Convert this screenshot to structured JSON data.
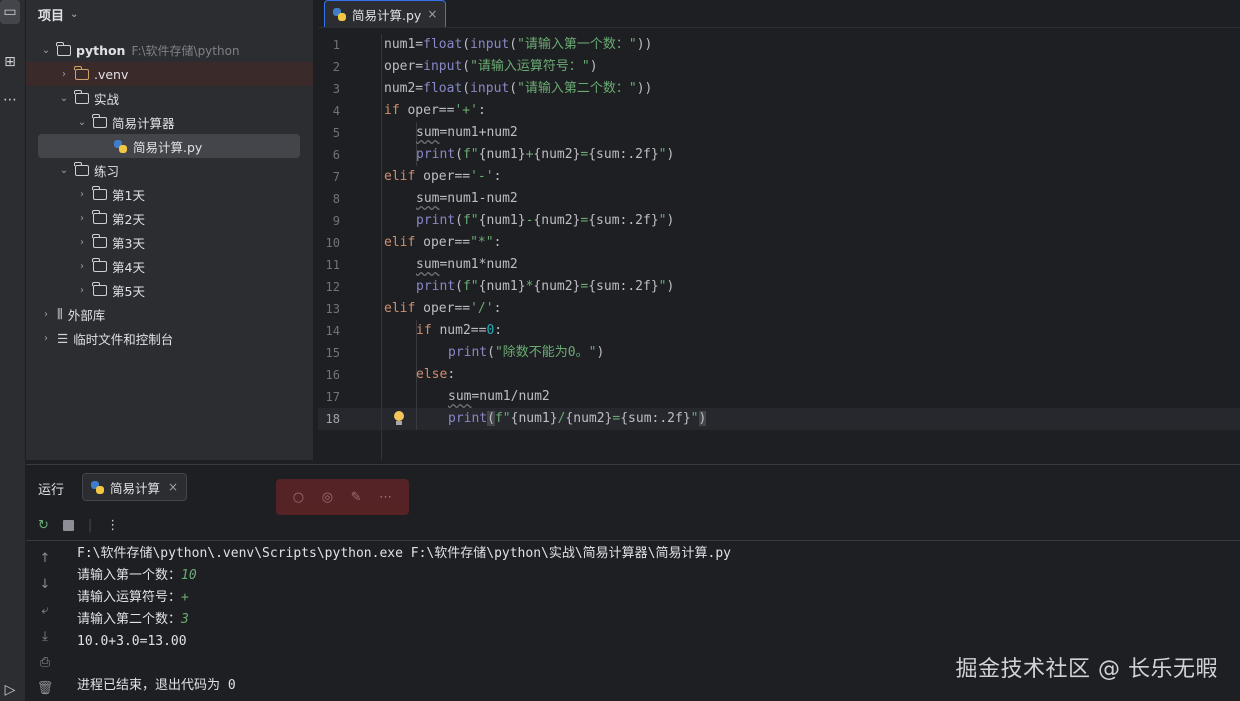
{
  "project_panel": {
    "title": "项目",
    "tree": [
      {
        "label": "python",
        "path": "F:\\软件存储\\python",
        "type": "folder",
        "expanded": true
      },
      {
        "label": ".venv",
        "type": "venv-folder",
        "expanded": false
      },
      {
        "label": "实战",
        "type": "folder",
        "expanded": true
      },
      {
        "label": "简易计算器",
        "type": "folder",
        "expanded": true
      },
      {
        "label": "简易计算.py",
        "type": "python-file"
      },
      {
        "label": "练习",
        "type": "folder",
        "expanded": true
      },
      {
        "label": "第1天",
        "type": "folder"
      },
      {
        "label": "第2天",
        "type": "folder"
      },
      {
        "label": "第3天",
        "type": "folder"
      },
      {
        "label": "第4天",
        "type": "folder"
      },
      {
        "label": "第5天",
        "type": "folder"
      },
      {
        "label": "外部库",
        "type": "library"
      },
      {
        "label": "临时文件和控制台",
        "type": "scratches"
      }
    ]
  },
  "editor": {
    "tab": "简易计算.py",
    "current_line": 18,
    "lines": [
      "1",
      "2",
      "3",
      "4",
      "5",
      "6",
      "7",
      "8",
      "9",
      "10",
      "11",
      "12",
      "13",
      "14",
      "15",
      "16",
      "17",
      "18"
    ],
    "code": {
      "l1": {
        "a": "num1=",
        "b": "float",
        "c": "(",
        "d": "input",
        "e": "(",
        "f": "\"请输入第一个数：\"",
        "g": "))"
      },
      "l2": {
        "a": "oper=",
        "b": "input",
        "c": "(",
        "d": "\"请输入运算符号：\"",
        "e": ")"
      },
      "l3": {
        "a": "num2=",
        "b": "float",
        "c": "(",
        "d": "input",
        "e": "(",
        "f": "\"请输入第二个数：\"",
        "g": "))"
      },
      "l4": {
        "kw": "if",
        "a": " oper==",
        "s": "'+'",
        "b": ":"
      },
      "l5": {
        "w": "sum",
        "a": "=num1+num2"
      },
      "l6": {
        "fn": "print",
        "a": "(",
        "s1": "f\"",
        "v1": "{num1}",
        "s2": "+",
        "v2": "{num2}",
        "s3": "=",
        "v3": "{sum:.2f}",
        "s4": "\"",
        "b": ")"
      },
      "l7": {
        "kw": "elif",
        "a": " oper==",
        "s": "'-'",
        "b": ":"
      },
      "l8": {
        "w": "sum",
        "a": "=num1-num2"
      },
      "l9": {
        "fn": "print",
        "a": "(",
        "s1": "f\"",
        "v1": "{num1}",
        "s2": "-",
        "v2": "{num2}",
        "s3": "=",
        "v3": "{sum:.2f}",
        "s4": "\"",
        "b": ")"
      },
      "l10": {
        "kw": "elif",
        "a": " oper==",
        "s": "\"*\"",
        "b": ":"
      },
      "l11": {
        "w": "sum",
        "a": "=num1*num2"
      },
      "l12": {
        "fn": "print",
        "a": "(",
        "s1": "f\"",
        "v1": "{num1}",
        "s2": "*",
        "v2": "{num2}",
        "s3": "=",
        "v3": "{sum:.2f}",
        "s4": "\"",
        "b": ")"
      },
      "l13": {
        "kw": "elif",
        "a": " oper==",
        "s": "'/'",
        "b": ":"
      },
      "l14": {
        "kw": "if",
        "a": " num2==",
        "n": "0",
        "b": ":"
      },
      "l15": {
        "fn": "print",
        "a": "(",
        "s": "\"除数不能为0。\"",
        "b": ")"
      },
      "l16": {
        "kw": "else",
        "a": ":"
      },
      "l17": {
        "w": "sum",
        "a": "=num1/num2"
      },
      "l18": {
        "fn": "print",
        "a": "(",
        "s1": "f\"",
        "v1": "{num1}",
        "s2": "/",
        "v2": "{num2}",
        "s3": "=",
        "v3": "{sum:.2f}",
        "s4": "\"",
        "b": ")"
      }
    }
  },
  "run_panel": {
    "title": "运行",
    "tab": "简易计算",
    "console": {
      "command": "F:\\软件存储\\python\\.venv\\Scripts\\python.exe F:\\软件存储\\python\\实战\\简易计算器\\简易计算.py",
      "prompt1": "请输入第一个数：",
      "input1": "10",
      "prompt2": "请输入运算符号：",
      "input2": "+",
      "prompt3": "请输入第二个数：",
      "input3": "3",
      "result": "10.0+3.0=13.00",
      "exit": "进程已结束，退出代码为 0"
    }
  },
  "watermark": "掘金技术社区 @ 长乐无暇"
}
